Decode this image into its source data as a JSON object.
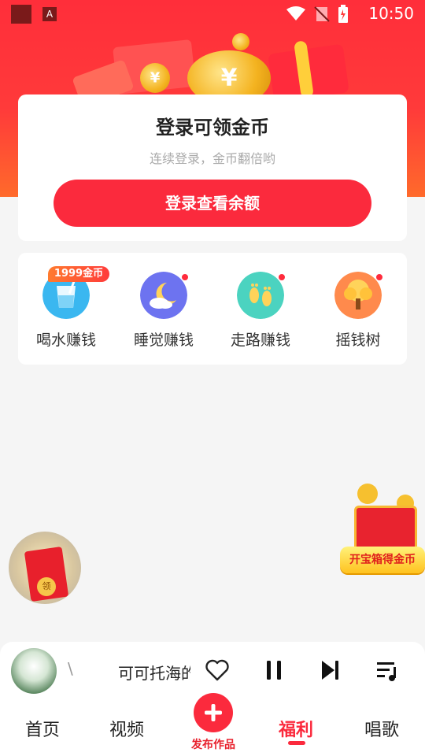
{
  "status_bar": {
    "time": "10:50",
    "app_icon_letter": "A"
  },
  "login_card": {
    "title": "登录可领金币",
    "subtitle": "连续登录，金币翻倍哟",
    "button_label": "登录查看余额"
  },
  "tasks": {
    "badge": "1999金币",
    "items": [
      {
        "label": "喝水赚钱",
        "icon": "water-cup-icon",
        "has_dot": false
      },
      {
        "label": "睡觉赚钱",
        "icon": "moon-cloud-icon",
        "has_dot": true
      },
      {
        "label": "走路赚钱",
        "icon": "footprints-icon",
        "has_dot": true
      },
      {
        "label": "摇钱树",
        "icon": "money-tree-icon",
        "has_dot": true
      }
    ]
  },
  "floating": {
    "red_packet_seal": "领",
    "treasure_label": "开宝箱得金币"
  },
  "player": {
    "prev_fragment": "\\",
    "song_title": "可可托海的"
  },
  "nav": {
    "items": [
      "首页",
      "视频",
      "福利",
      "唱歌"
    ],
    "active": "福利",
    "publish_label": "发布作品"
  },
  "colors": {
    "accent": "#fb2a3d",
    "hero_top": "#ff2e3a",
    "hero_bottom": "#ff6a2b"
  }
}
